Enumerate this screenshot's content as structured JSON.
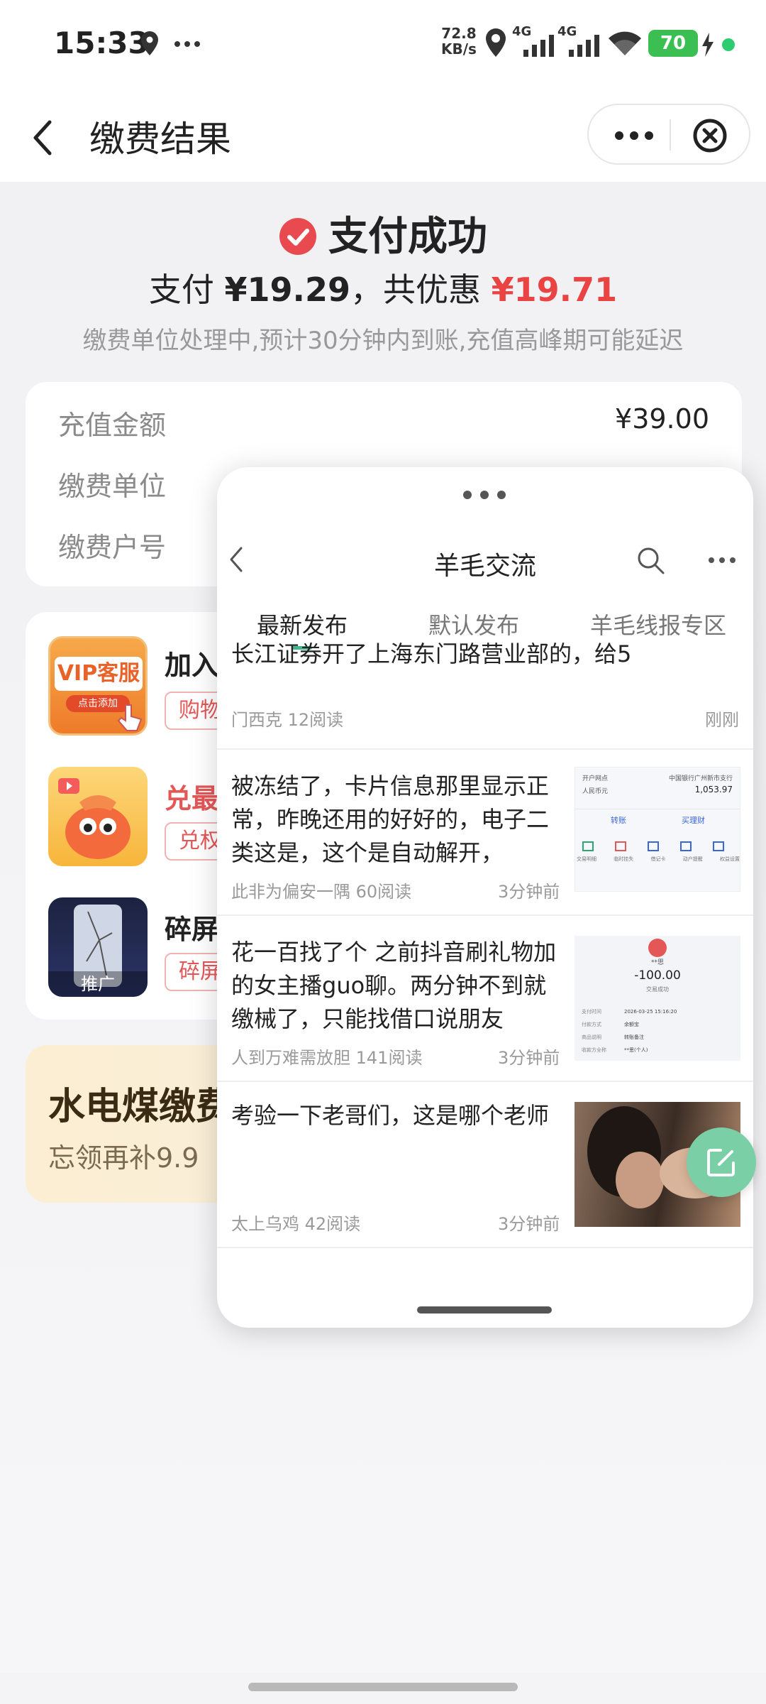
{
  "status_bar": {
    "time": "15:33",
    "net_speed_value": "72.8",
    "net_speed_unit": "KB/s",
    "network1": "4G",
    "network2": "4G",
    "battery": "70",
    "battery_level": 0.7
  },
  "nav": {
    "title": "缴费结果"
  },
  "result": {
    "status_text": "支付成功",
    "pay_label": "支付",
    "pay_amount": "¥19.29",
    "discount_label": "，共优惠",
    "discount_amount": "¥19.71",
    "note": "缴费单位处理中,预计30分钟内到账,充值高峰期可能延迟"
  },
  "info": {
    "rows": [
      {
        "label": "充值金额",
        "value": "¥39.00"
      },
      {
        "label": "缴费单位",
        "value": ""
      },
      {
        "label": "缴费户号",
        "value": ""
      }
    ]
  },
  "recommend": {
    "items": [
      {
        "img_text": "VIP客服",
        "img_sub": "点击添加",
        "title": "加入",
        "tag": "购物"
      },
      {
        "img_text": "",
        "title": "兑最",
        "tag": "兑权"
      },
      {
        "img_text": "推广",
        "title": "碎屏",
        "tag": "碎屏"
      }
    ]
  },
  "utility": {
    "title": "水电煤缴费",
    "subtitle": "忘领再补9.9"
  },
  "overlay": {
    "title": "羊毛交流",
    "tabs": [
      "最新发布",
      "默认发布",
      "羊毛线报专区"
    ],
    "active_tab": 0,
    "posts": [
      {
        "text": "长江证券开了上海东门路营业部的，给5",
        "author": "门西克",
        "reads": "12阅读",
        "time": "刚刚"
      },
      {
        "text": "被冻结了，卡片信息那里显示正常，昨晚还用的好好的，电子二类这是，这个是自动解开，",
        "author": "此非为偏安一隅",
        "reads": "60阅读",
        "time": "3分钟前",
        "thumb": {
          "type": "bank",
          "l1": "开户网点",
          "r1": "中国银行广州新市支行",
          "l2": "人民币元",
          "r2": "1,053.97",
          "b1": "转账",
          "b2": "买理财",
          "icons": [
            "交易明细",
            "临时挂失",
            "借记卡",
            "动户提醒",
            "权益设置"
          ]
        }
      },
      {
        "text": "花一百找了个 之前抖音刷礼物加的女主播guo聊。两分钟不到就缴械了，只能找借口说朋友",
        "author": "人到万难需放胆",
        "reads": "141阅读",
        "time": "3分钟前",
        "thumb": {
          "type": "receipt",
          "name": "**思",
          "amount": "-100.00",
          "status": "交易成功",
          "rows": [
            [
              "支付时间",
              "2026-03-25 15:16:20"
            ],
            [
              "付款方式",
              "余额宝"
            ],
            [
              "商品说明",
              "转账备注"
            ],
            [
              "收款方全称",
              "**思(个人)"
            ]
          ]
        }
      },
      {
        "text": "考验一下老哥们，这是哪个老师",
        "author": "太上乌鸡",
        "reads": "42阅读",
        "time": "3分钟前",
        "thumb": {
          "type": "photo"
        }
      }
    ]
  },
  "colors": {
    "accent_red": "#e94343",
    "accent_green": "#3fb68b",
    "success_icon": "#e84a4f"
  }
}
